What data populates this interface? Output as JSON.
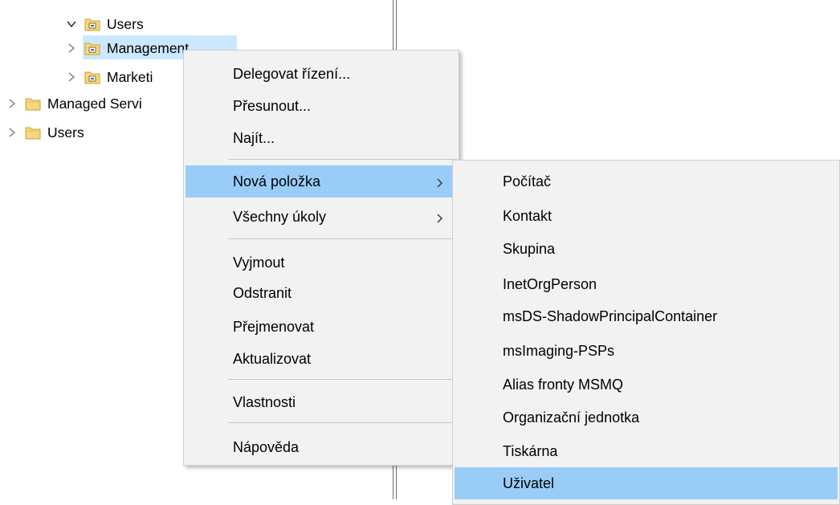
{
  "tree": {
    "items": [
      {
        "label": "Users",
        "expanded": true,
        "icon": "ou-folder-icon"
      },
      {
        "label": "Management",
        "expanded": false,
        "selected": true,
        "icon": "ou-folder-icon"
      },
      {
        "label": "Marketi",
        "expanded": false,
        "icon": "ou-folder-icon"
      },
      {
        "label": "Managed Servi",
        "expanded": false,
        "icon": "folder-icon"
      },
      {
        "label": "Users",
        "expanded": false,
        "icon": "folder-icon"
      }
    ]
  },
  "context_menu": {
    "items": [
      {
        "label": "Delegovat řízení..."
      },
      {
        "label": "Přesunout..."
      },
      {
        "label": "Najít..."
      },
      {
        "label": "Nová položka",
        "has_submenu": true,
        "highlighted": true
      },
      {
        "label": "Všechny úkoly",
        "has_submenu": true
      },
      {
        "label": "Vyjmout"
      },
      {
        "label": "Odstranit"
      },
      {
        "label": "Přejmenovat"
      },
      {
        "label": "Aktualizovat"
      },
      {
        "label": "Vlastnosti"
      },
      {
        "label": "Nápověda"
      }
    ]
  },
  "submenu": {
    "items": [
      {
        "label": "Počítač"
      },
      {
        "label": "Kontakt"
      },
      {
        "label": "Skupina"
      },
      {
        "label": "InetOrgPerson"
      },
      {
        "label": "msDS-ShadowPrincipalContainer"
      },
      {
        "label": "msImaging-PSPs"
      },
      {
        "label": "Alias fronty MSMQ"
      },
      {
        "label": "Organizační jednotka"
      },
      {
        "label": "Tiskárna"
      },
      {
        "label": "Uživatel",
        "highlighted": true
      }
    ]
  },
  "colors": {
    "selection": "#cce8ff",
    "menu_highlight": "#99cdf7",
    "menu_background": "#f2f2f2",
    "folder": "#f5d77f"
  }
}
